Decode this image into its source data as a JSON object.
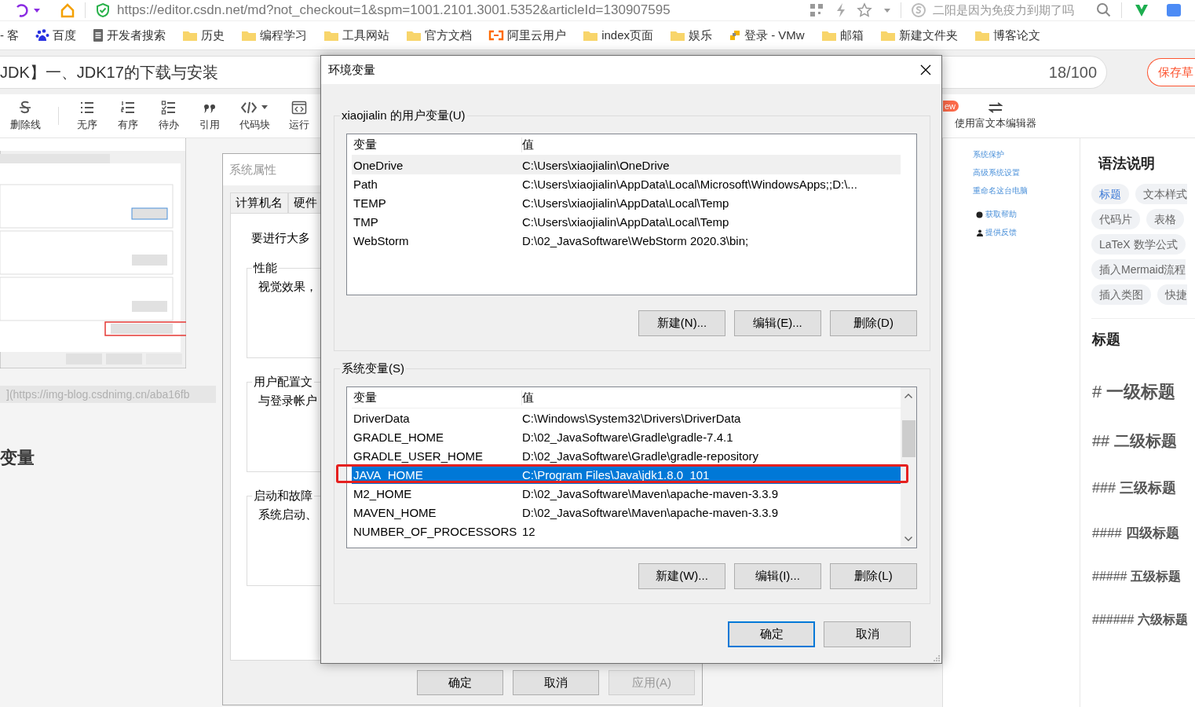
{
  "browser": {
    "url": "https://editor.csdn.net/md?not_checkout=1&spm=1001.2101.3001.5352&articleId=130907595",
    "search_text": "二阳是因为免疫力到期了吗",
    "bookmarks": [
      {
        "label": "- 客",
        "kind": "plain"
      },
      {
        "label": "百度",
        "kind": "baidu"
      },
      {
        "label": "开发者搜索",
        "kind": "doc"
      },
      {
        "label": "历史",
        "kind": "folder"
      },
      {
        "label": "编程学习",
        "kind": "folder"
      },
      {
        "label": "工具网站",
        "kind": "folder"
      },
      {
        "label": "官方文档",
        "kind": "folder"
      },
      {
        "label": "阿里云用户",
        "kind": "aliyun"
      },
      {
        "label": "index页面",
        "kind": "folder"
      },
      {
        "label": "娱乐",
        "kind": "folder"
      },
      {
        "label": "登录 - VMw",
        "kind": "vmware"
      },
      {
        "label": "邮箱",
        "kind": "folder"
      },
      {
        "label": "新建文件夹",
        "kind": "folder"
      },
      {
        "label": "博客论文",
        "kind": "folder"
      }
    ]
  },
  "editor": {
    "title": "JDK】一、JDK17的下载与安装",
    "title_count": "18/100",
    "save_button": "保存草",
    "toolbar": [
      {
        "label": "删除线",
        "kind": "strike"
      },
      {
        "label": "无序",
        "kind": "ul"
      },
      {
        "label": "有序",
        "kind": "ol"
      },
      {
        "label": "待办",
        "kind": "todo"
      },
      {
        "label": "引用",
        "kind": "quote"
      },
      {
        "label": "代码块",
        "kind": "code"
      },
      {
        "label": "运行",
        "kind": "run"
      }
    ],
    "new_badge": "ew",
    "rich_text_toggle": "使用富文本编辑器",
    "content": {
      "link_line": "](https://img-blog.csdnimg.cn/aba16fb",
      "heading": "变量"
    },
    "preview_links": [
      {
        "label": "系统保护",
        "kind": "link"
      },
      {
        "label": "高级系统设置",
        "kind": "link"
      },
      {
        "label": "重命名这台电脑",
        "kind": "link"
      },
      {
        "label": "获取帮助",
        "kind": "help"
      },
      {
        "label": "提供反馈",
        "kind": "feedback"
      }
    ],
    "syntax_panel": {
      "title": "语法说明",
      "tag_rows": [
        [
          {
            "label": "标题",
            "selected": true
          },
          {
            "label": "文本样式",
            "selected": false
          }
        ],
        [
          {
            "label": "代码片",
            "selected": false
          },
          {
            "label": "表格",
            "selected": false
          }
        ],
        [
          {
            "label": "LaTeX 数学公式",
            "selected": false
          }
        ],
        [
          {
            "label": "插入Mermaid流程",
            "selected": false
          }
        ],
        [
          {
            "label": "插入类图",
            "selected": false
          },
          {
            "label": "快捷",
            "selected": false
          }
        ]
      ],
      "section_title": "标题",
      "headings": [
        {
          "marks": "#",
          "text": "一级标题"
        },
        {
          "marks": "##",
          "text": "二级标题"
        },
        {
          "marks": "###",
          "text": "三级标题"
        },
        {
          "marks": "####",
          "text": "四级标题"
        },
        {
          "marks": "#####",
          "text": "五级标题"
        },
        {
          "marks": "######",
          "text": "六级标题"
        }
      ]
    }
  },
  "system_properties": {
    "title": "系统属性",
    "tabs": [
      {
        "label": "计算机名",
        "selected": false
      },
      {
        "label": "硬件",
        "selected": false
      }
    ],
    "intro": "要进行大多",
    "groups": [
      {
        "legend": "性能",
        "text": "视觉效果，"
      },
      {
        "legend": "用户配置文",
        "text": "与登录帐户"
      },
      {
        "legend": "启动和故障",
        "text": "系统启动、"
      }
    ],
    "buttons": [
      {
        "label": "确定",
        "disabled": false
      },
      {
        "label": "取消",
        "disabled": false
      },
      {
        "label": "应用(A)",
        "disabled": true
      }
    ]
  },
  "env_dialog": {
    "title": "环境变量",
    "groups": [
      {
        "legend": "xiaojialin 的用户变量(U)",
        "focused": false,
        "columns": [
          "变量",
          "值"
        ],
        "rows": [
          {
            "name": "OneDrive",
            "value": "C:\\Users\\xiaojialin\\OneDrive",
            "selected": true
          },
          {
            "name": "Path",
            "value": "C:\\Users\\xiaojialin\\AppData\\Local\\Microsoft\\WindowsApps;;D:\\...",
            "selected": false
          },
          {
            "name": "TEMP",
            "value": "C:\\Users\\xiaojialin\\AppData\\Local\\Temp",
            "selected": false
          },
          {
            "name": "TMP",
            "value": "C:\\Users\\xiaojialin\\AppData\\Local\\Temp",
            "selected": false
          },
          {
            "name": "WebStorm",
            "value": "D:\\02_JavaSoftware\\WebStorm 2020.3\\bin;",
            "selected": false
          }
        ],
        "buttons": [
          "新建(N)...",
          "编辑(E)...",
          "删除(D)"
        ]
      },
      {
        "legend": "系统变量(S)",
        "focused": true,
        "columns": [
          "变量",
          "值"
        ],
        "rows": [
          {
            "name": "DriverData",
            "value": "C:\\Windows\\System32\\Drivers\\DriverData",
            "selected": false
          },
          {
            "name": "GRADLE_HOME",
            "value": "D:\\02_JavaSoftware\\Gradle\\gradle-7.4.1",
            "selected": false
          },
          {
            "name": "GRADLE_USER_HOME",
            "value": "D:\\02_JavaSoftware\\Gradle\\gradle-repository",
            "selected": false
          },
          {
            "name": "JAVA_HOME",
            "value": "C:\\Program Files\\Java\\jdk1.8.0_101",
            "selected": true
          },
          {
            "name": "M2_HOME",
            "value": "D:\\02_JavaSoftware\\Maven\\apache-maven-3.3.9",
            "selected": false
          },
          {
            "name": "MAVEN_HOME",
            "value": "D:\\02_JavaSoftware\\Maven\\apache-maven-3.3.9",
            "selected": false
          },
          {
            "name": "NUMBER_OF_PROCESSORS",
            "value": "12",
            "selected": false
          }
        ],
        "buttons": [
          "新建(W)...",
          "编辑(I)...",
          "删除(L)"
        ]
      }
    ],
    "buttons": [
      {
        "label": "确定",
        "default": true
      },
      {
        "label": "取消",
        "default": false
      }
    ]
  }
}
